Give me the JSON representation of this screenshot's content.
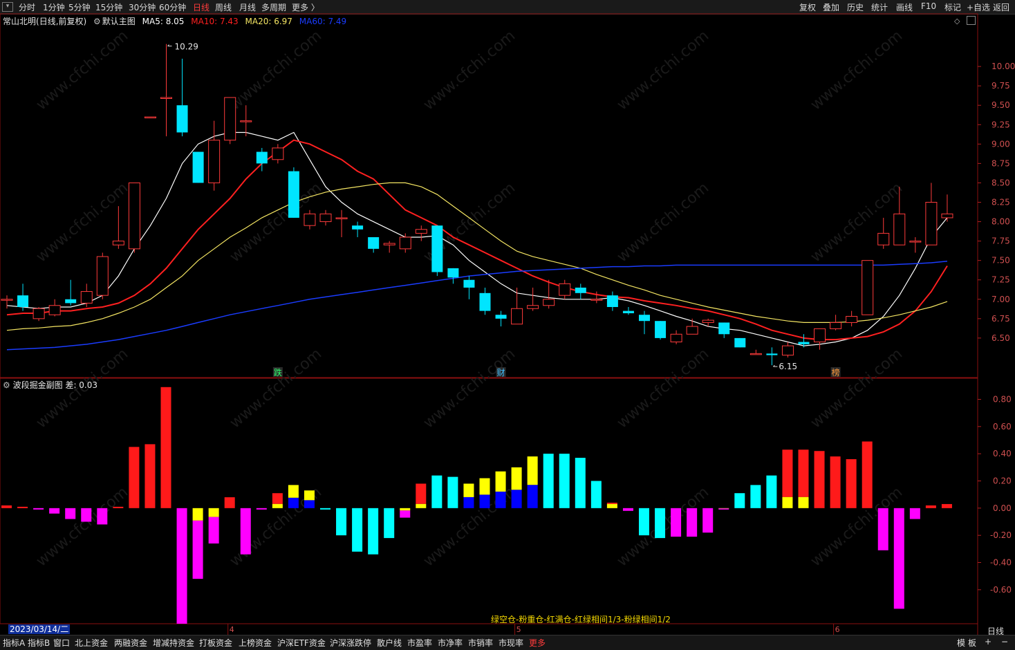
{
  "toolbar_left": [
    "分时",
    "1分钟",
    "5分钟",
    "15分钟",
    "30分钟",
    "60分钟",
    "日线",
    "周线",
    "月线",
    "多周期",
    "更多 〉"
  ],
  "toolbar_active": "日线",
  "toolbar_right": [
    "复权",
    "叠加",
    "历史",
    "统计",
    "画线",
    "F10",
    "标记",
    "+自选",
    "返回"
  ],
  "header": {
    "stock": "常山北明",
    "period": "(日线,前复权)",
    "template": "默认主图",
    "ma5": "MA5: 8.05",
    "ma10": "MA10: 7.43",
    "ma20": "MA20: 6.97",
    "ma60": "MA60: 7.49"
  },
  "subchart": {
    "title": "波段掘金副图",
    "diff": "差: 0.03",
    "formula": "绿空仓-粉重仓-红满仓-红绿相间1/3-粉绿相间1/2"
  },
  "date_label": "2023/03/14/二",
  "x_month_labels": [
    "4",
    "5",
    "6"
  ],
  "period_label": "日线",
  "bottom_tabs": [
    "指标A",
    "指标B",
    "窗口",
    "北上资金",
    "两融资金",
    "增减持资金",
    "打板资金",
    "上榜资金",
    "沪深ETF资金",
    "沪深涨跌停",
    "散户线",
    "市盈率",
    "市净率",
    "市销率",
    "市现率",
    "更多"
  ],
  "bottom_right": [
    "模",
    "板",
    "+",
    "−"
  ],
  "event_marks": [
    {
      "text": "跌",
      "color": "#2cff6a"
    },
    {
      "text": "财",
      "color": "#40c0ff"
    },
    {
      "text": "榜",
      "color": "#ff9a3a"
    }
  ],
  "annotations": {
    "high": "10.29",
    "low": "6.15"
  },
  "watermark": "www.cfchi.com",
  "colors": {
    "up": "#ff3b3b",
    "down": "#00e5ff",
    "ma5": "#ffffff",
    "ma10": "#ff2020",
    "ma20": "#f5e663",
    "ma60": "#1a3cff"
  },
  "chart_data": [
    {
      "type": "candlestick",
      "title": "常山北明 (日线,前复权)",
      "y_ticks": [
        6.5,
        6.75,
        7.0,
        7.25,
        7.5,
        7.75,
        8.0,
        8.25,
        8.5,
        8.75,
        9.0,
        9.25,
        9.5,
        9.75,
        10.0
      ],
      "ylim": [
        6.0,
        10.5
      ],
      "candles": [
        [
          7.0,
          7.0,
          7.05,
          6.88
        ],
        [
          7.05,
          6.9,
          7.2,
          6.85
        ],
        [
          6.75,
          6.88,
          6.9,
          6.72
        ],
        [
          6.8,
          6.92,
          7.0,
          6.78
        ],
        [
          7.0,
          6.95,
          7.25,
          6.92
        ],
        [
          6.95,
          7.1,
          7.2,
          6.9
        ],
        [
          7.05,
          7.55,
          7.6,
          7.0
        ],
        [
          7.7,
          7.75,
          8.2,
          7.65
        ],
        [
          7.65,
          8.5,
          8.5,
          7.6
        ],
        [
          9.35,
          9.35,
          9.35,
          9.35
        ],
        [
          9.6,
          9.6,
          10.29,
          9.1
        ],
        [
          9.5,
          9.15,
          10.1,
          9.1
        ],
        [
          8.9,
          8.5,
          8.9,
          8.5
        ],
        [
          8.5,
          9.05,
          9.3,
          8.4
        ],
        [
          9.05,
          9.6,
          9.6,
          9.0
        ],
        [
          9.3,
          9.3,
          9.5,
          9.1
        ],
        [
          8.9,
          8.75,
          8.95,
          8.65
        ],
        [
          8.8,
          8.95,
          9.0,
          8.75
        ],
        [
          8.65,
          8.05,
          8.7,
          8.05
        ],
        [
          7.95,
          8.1,
          8.15,
          7.9
        ],
        [
          8.0,
          8.1,
          8.15,
          7.95
        ],
        [
          8.05,
          8.05,
          8.15,
          7.8
        ],
        [
          7.95,
          7.9,
          8.0,
          7.8
        ],
        [
          7.8,
          7.65,
          7.8,
          7.6
        ],
        [
          7.7,
          7.72,
          7.75,
          7.6
        ],
        [
          7.65,
          7.8,
          7.85,
          7.6
        ],
        [
          7.85,
          7.9,
          7.95,
          7.75
        ],
        [
          7.95,
          7.35,
          7.95,
          7.3
        ],
        [
          7.4,
          7.28,
          7.4,
          7.2
        ],
        [
          7.25,
          7.15,
          7.3,
          7.0
        ],
        [
          7.08,
          6.85,
          7.15,
          6.8
        ],
        [
          6.8,
          6.75,
          6.85,
          6.65
        ],
        [
          6.68,
          6.88,
          7.15,
          6.68
        ],
        [
          6.88,
          6.92,
          7.15,
          6.85
        ],
        [
          6.92,
          7.0,
          7.25,
          6.88
        ],
        [
          7.05,
          7.2,
          7.25,
          7.0
        ],
        [
          7.15,
          7.08,
          7.2,
          7.0
        ],
        [
          7.0,
          7.0,
          7.1,
          6.95
        ],
        [
          7.05,
          6.9,
          7.1,
          6.85
        ],
        [
          6.85,
          6.82,
          6.9,
          6.8
        ],
        [
          6.8,
          6.72,
          6.85,
          6.55
        ],
        [
          6.72,
          6.5,
          6.72,
          6.48
        ],
        [
          6.45,
          6.55,
          6.6,
          6.42
        ],
        [
          6.55,
          6.65,
          6.75,
          6.55
        ],
        [
          6.7,
          6.73,
          6.75,
          6.65
        ],
        [
          6.7,
          6.55,
          6.7,
          6.5
        ],
        [
          6.5,
          6.38,
          6.5,
          6.38
        ],
        [
          6.3,
          6.3,
          6.35,
          6.3
        ],
        [
          6.3,
          6.28,
          6.38,
          6.15
        ],
        [
          6.28,
          6.4,
          6.45,
          6.25
        ],
        [
          6.45,
          6.42,
          6.55,
          6.38
        ],
        [
          6.45,
          6.62,
          6.62,
          6.35
        ],
        [
          6.62,
          6.7,
          6.8,
          6.6
        ],
        [
          6.7,
          6.78,
          6.85,
          6.65
        ],
        [
          6.8,
          7.5,
          7.5,
          6.8
        ],
        [
          7.7,
          7.85,
          8.05,
          7.65
        ],
        [
          7.7,
          8.1,
          8.45,
          7.7
        ],
        [
          7.75,
          7.75,
          7.8,
          7.6
        ],
        [
          7.7,
          8.25,
          8.5,
          7.7
        ],
        [
          8.05,
          8.1,
          8.35,
          8.0
        ]
      ],
      "series": [
        {
          "name": "MA5",
          "values": [
            6.92,
            6.9,
            6.88,
            6.9,
            6.9,
            6.95,
            7.05,
            7.3,
            7.65,
            7.95,
            8.3,
            8.75,
            9.0,
            9.1,
            9.15,
            9.15,
            9.1,
            9.05,
            9.15,
            8.8,
            8.45,
            8.25,
            8.1,
            8.0,
            7.9,
            7.8,
            7.8,
            7.82,
            7.7,
            7.5,
            7.35,
            7.2,
            7.08,
            7.05,
            7.02,
            7.0,
            7.0,
            7.0,
            7.02,
            6.98,
            6.92,
            6.85,
            6.78,
            6.72,
            6.65,
            6.62,
            6.6,
            6.55,
            6.5,
            6.45,
            6.4,
            6.42,
            6.45,
            6.5,
            6.6,
            6.78,
            7.05,
            7.4,
            7.8,
            8.05
          ]
        },
        {
          "name": "MA10",
          "values": [
            6.8,
            6.82,
            6.82,
            6.85,
            6.85,
            6.88,
            6.9,
            6.95,
            7.05,
            7.2,
            7.4,
            7.65,
            7.9,
            8.1,
            8.3,
            8.55,
            8.75,
            8.9,
            9.05,
            9.0,
            8.9,
            8.8,
            8.65,
            8.55,
            8.35,
            8.15,
            8.05,
            7.95,
            7.8,
            7.7,
            7.6,
            7.5,
            7.4,
            7.3,
            7.22,
            7.15,
            7.1,
            7.06,
            7.03,
            7.02,
            6.98,
            6.95,
            6.92,
            6.88,
            6.85,
            6.8,
            6.75,
            6.68,
            6.6,
            6.55,
            6.5,
            6.48,
            6.48,
            6.5,
            6.52,
            6.58,
            6.68,
            6.85,
            7.1,
            7.43
          ]
        },
        {
          "name": "MA20",
          "values": [
            6.6,
            6.62,
            6.63,
            6.65,
            6.66,
            6.7,
            6.75,
            6.82,
            6.9,
            7.0,
            7.15,
            7.3,
            7.5,
            7.65,
            7.8,
            7.92,
            8.05,
            8.15,
            8.25,
            8.32,
            8.38,
            8.42,
            8.45,
            8.48,
            8.5,
            8.5,
            8.45,
            8.35,
            8.2,
            8.05,
            7.9,
            7.75,
            7.62,
            7.55,
            7.5,
            7.45,
            7.4,
            7.32,
            7.25,
            7.18,
            7.12,
            7.05,
            7.0,
            6.95,
            6.9,
            6.86,
            6.82,
            6.78,
            6.75,
            6.72,
            6.7,
            6.7,
            6.7,
            6.71,
            6.73,
            6.76,
            6.8,
            6.85,
            6.9,
            6.97
          ]
        },
        {
          "name": "MA60",
          "values": [
            6.35,
            6.36,
            6.37,
            6.38,
            6.4,
            6.42,
            6.45,
            6.48,
            6.52,
            6.56,
            6.6,
            6.65,
            6.7,
            6.75,
            6.8,
            6.84,
            6.88,
            6.92,
            6.96,
            7.0,
            7.03,
            7.06,
            7.09,
            7.12,
            7.15,
            7.18,
            7.21,
            7.24,
            7.27,
            7.3,
            7.32,
            7.34,
            7.36,
            7.37,
            7.38,
            7.39,
            7.4,
            7.41,
            7.42,
            7.42,
            7.43,
            7.43,
            7.44,
            7.44,
            7.44,
            7.44,
            7.44,
            7.44,
            7.44,
            7.44,
            7.44,
            7.44,
            7.44,
            7.44,
            7.44,
            7.44,
            7.45,
            7.46,
            7.47,
            7.49
          ]
        }
      ]
    },
    {
      "type": "bar",
      "title": "波段掘金副图",
      "y_ticks": [
        -0.6,
        -0.4,
        -0.2,
        0.0,
        0.2,
        0.4,
        0.6,
        0.8
      ],
      "ylim": [
        -0.85,
        0.95
      ],
      "bars": [
        [
          0.02,
          "red"
        ],
        [
          0.01,
          "red"
        ],
        [
          -0.01,
          "magenta"
        ],
        [
          -0.04,
          "magenta"
        ],
        [
          -0.08,
          "magenta"
        ],
        [
          -0.1,
          "magenta"
        ],
        [
          -0.12,
          "magenta"
        ],
        [
          0.01,
          "red"
        ],
        [
          0.45,
          "red"
        ],
        [
          0.47,
          "red"
        ],
        [
          0.89,
          "red"
        ],
        [
          -0.85,
          "magenta"
        ],
        [
          -0.52,
          "ym"
        ],
        [
          -0.26,
          "ym"
        ],
        [
          0.08,
          "red"
        ],
        [
          -0.34,
          "magenta"
        ],
        [
          -0.01,
          "magenta"
        ],
        [
          0.11,
          "ry"
        ],
        [
          0.17,
          "by"
        ],
        [
          0.13,
          "by"
        ],
        [
          -0.01,
          "cyan"
        ],
        [
          -0.2,
          "cyan"
        ],
        [
          -0.32,
          "cyan"
        ],
        [
          -0.34,
          "cyan"
        ],
        [
          -0.22,
          "cyan"
        ],
        [
          -0.07,
          "ym"
        ],
        [
          0.18,
          "ry"
        ],
        [
          0.24,
          "cyan"
        ],
        [
          0.23,
          "cyan"
        ],
        [
          0.18,
          "by"
        ],
        [
          0.22,
          "by"
        ],
        [
          0.27,
          "by"
        ],
        [
          0.3,
          "by"
        ],
        [
          0.38,
          "by"
        ],
        [
          0.4,
          "cyan"
        ],
        [
          0.4,
          "cyan"
        ],
        [
          0.37,
          "cyan"
        ],
        [
          0.2,
          "cyan"
        ],
        [
          0.04,
          "ry"
        ],
        [
          -0.02,
          "magenta"
        ],
        [
          -0.2,
          "cyan"
        ],
        [
          -0.22,
          "cyan"
        ],
        [
          -0.21,
          "magenta"
        ],
        [
          -0.21,
          "magenta"
        ],
        [
          -0.18,
          "magenta"
        ],
        [
          -0.01,
          "ym"
        ],
        [
          0.11,
          "cyan"
        ],
        [
          0.17,
          "cyan"
        ],
        [
          0.24,
          "cyan"
        ],
        [
          0.43,
          "ry"
        ],
        [
          0.43,
          "ry"
        ],
        [
          0.42,
          "red"
        ],
        [
          0.38,
          "red"
        ],
        [
          0.36,
          "red"
        ],
        [
          0.49,
          "red"
        ],
        [
          -0.31,
          "magenta"
        ],
        [
          -0.74,
          "magenta"
        ],
        [
          -0.08,
          "magenta"
        ],
        [
          0.02,
          "red"
        ],
        [
          0.03,
          "red"
        ]
      ]
    }
  ]
}
